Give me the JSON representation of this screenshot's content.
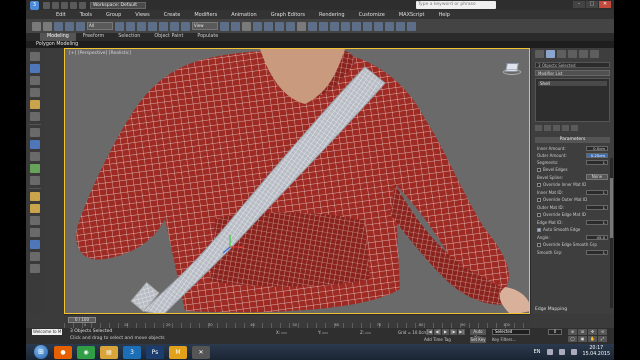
{
  "app": {
    "logo_glyph": "3",
    "workspace": "Workspace: Default",
    "search_placeholder": "Type a keyword or phrase",
    "window_buttons": [
      "–",
      "□",
      "✕"
    ]
  },
  "menu": [
    "Edit",
    "Tools",
    "Group",
    "Views",
    "Create",
    "Modifiers",
    "Animation",
    "Graph Editors",
    "Rendering",
    "Customize",
    "MAXScript",
    "Help"
  ],
  "toolbar": {
    "selection_filter": "All",
    "ref_coord": "View"
  },
  "ribbon": {
    "tabs": [
      "Modeling",
      "Freeform",
      "Selection",
      "Object Paint",
      "Populate"
    ],
    "active_tab": "Modeling",
    "sub_label": "Polygon Modeling"
  },
  "viewport": {
    "label": "[+] [Perspective] [Realistic]",
    "accent": "#f1c232",
    "mesh_color": "#9e2a24",
    "wire_color": "#f2dcd6",
    "strap_color": "#b8bcc4"
  },
  "command_panel": {
    "object_field": "3 Objects Selected",
    "modifier_list": "Modifier List",
    "stack_item": "Shell",
    "rollout": "Parameters",
    "inner_amount_label": "Inner Amount:",
    "inner_amount": "0.0cm",
    "outer_amount_label": "Outer Amount:",
    "outer_amount": "0.25cm",
    "segments_label": "Segments:",
    "segments": "1",
    "bevel_edges": "Bevel Edges",
    "bevel_spline_label": "Bevel Spline:",
    "bevel_spline_btn": "None",
    "override_inner": "Override Inner Mat ID",
    "inner_mat_label": "Inner Mat ID:",
    "inner_mat": "1",
    "override_outer": "Override Outer Mat ID",
    "outer_mat_label": "Outer Mat ID:",
    "outer_mat": "1",
    "override_edge": "Override Edge Mat ID",
    "edge_mat_label": "Edge Mat ID:",
    "edge_mat": "1",
    "auto_smooth": "Auto Smooth Edge",
    "angle_label": "Angle:",
    "angle": "45.0",
    "override_smooth": "Override Edge Smooth Grp",
    "smooth_grp_label": "Smooth Grp:",
    "smooth_grp": "1",
    "footer": "Edge Mapping"
  },
  "timeline": {
    "slider": "0 / 100",
    "ticks": [
      "0",
      "10",
      "20",
      "30",
      "40",
      "50",
      "60",
      "70",
      "80",
      "90",
      "100"
    ]
  },
  "status": {
    "maxscript": "Welcome to M",
    "selected": "3 Objects Selected",
    "prompt": "Click and drag to select and move objects",
    "x_label": "X:",
    "x": "",
    "y_label": "Y:",
    "y": "",
    "z_label": "Z:",
    "z": "",
    "grid": "Grid = 10.0cm",
    "add_time_tag": "Add Time Tag",
    "auto_key": "Auto Key",
    "set_key": "Set Key",
    "selected_dd": "Selected",
    "key_filters": "Key Filters...",
    "frame": "0",
    "play_buttons": [
      "|◀",
      "◀|",
      "▶",
      "|▶",
      "▶|"
    ],
    "nav_buttons": [
      "⊕",
      "⊞",
      "✥",
      "⟲",
      "◯",
      "▣",
      "✋",
      "⤢"
    ]
  },
  "taskbar": {
    "start_glyph": "⊞",
    "apps": [
      {
        "name": "firefox",
        "glyph": "●",
        "color": "#e66000"
      },
      {
        "name": "chrome",
        "glyph": "◉",
        "color": "#2f9e44"
      },
      {
        "name": "explorer",
        "glyph": "▤",
        "color": "#d9a53a"
      },
      {
        "name": "3dsmax",
        "glyph": "3",
        "color": "#1c6fb7"
      },
      {
        "name": "photoshop",
        "glyph": "Ps",
        "color": "#1b3d6d"
      },
      {
        "name": "mudbox",
        "glyph": "M",
        "color": "#e2a11b"
      },
      {
        "name": "tool",
        "glyph": "✕",
        "color": "#555555"
      }
    ],
    "lang": "EN",
    "time": "20:17",
    "date": "15.04.2015"
  }
}
